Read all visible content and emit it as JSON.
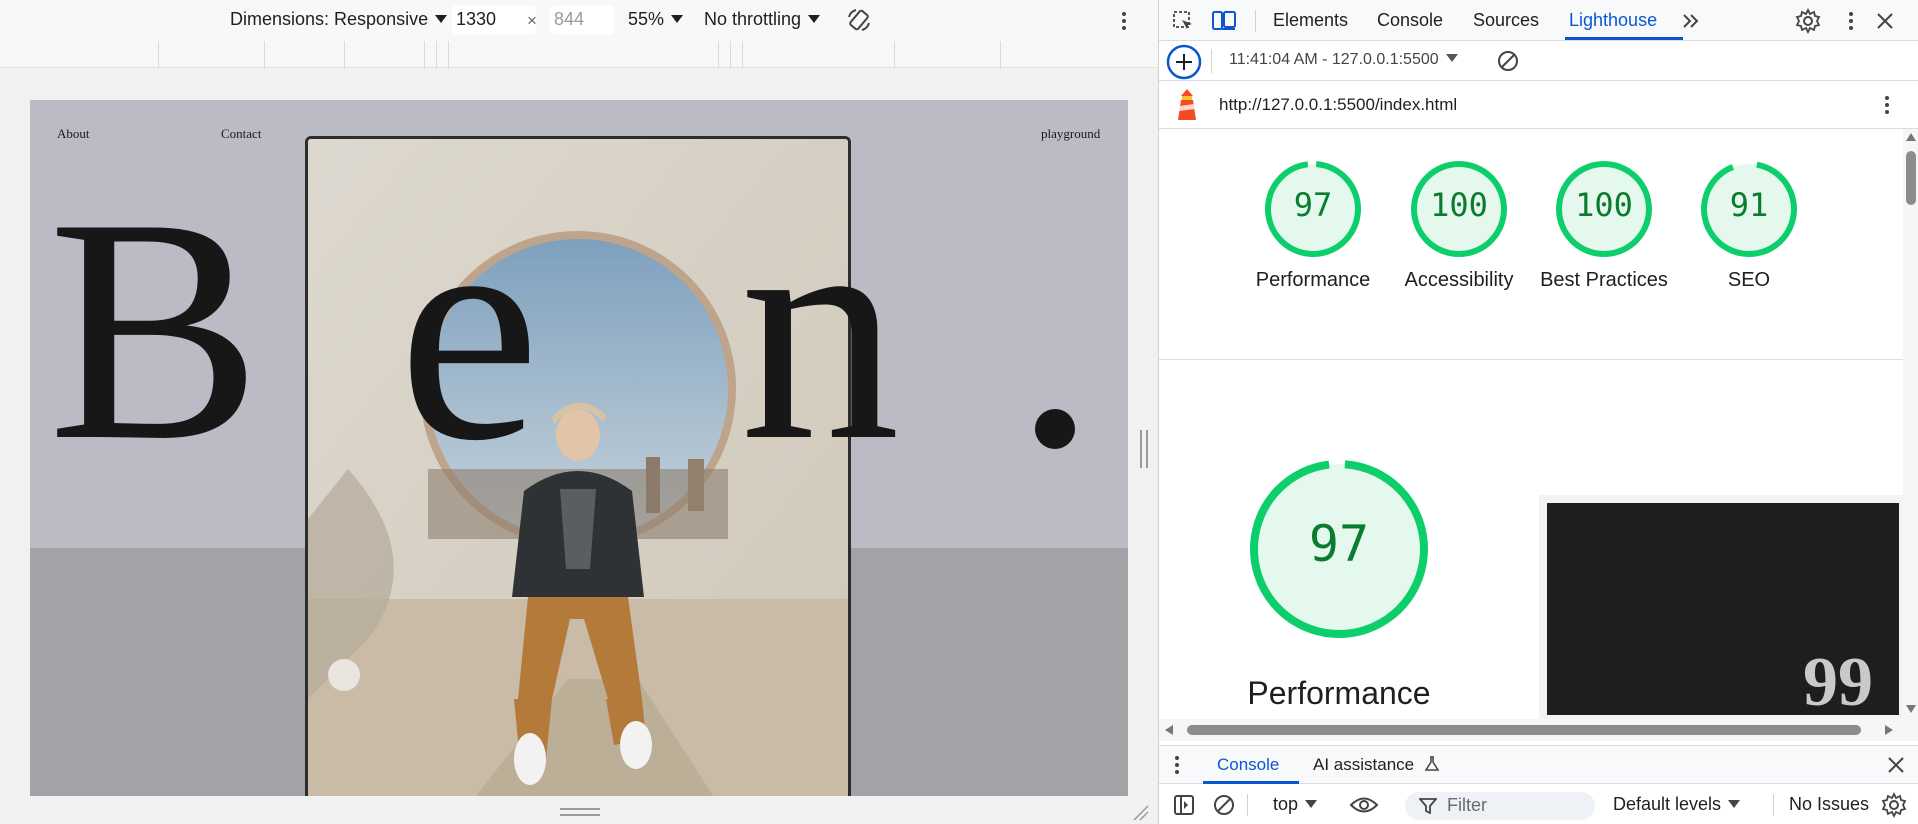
{
  "device_toolbar": {
    "dimensions_label": "Dimensions: Responsive",
    "width_value": "1330",
    "times_symbol": "×",
    "height_placeholder": "844",
    "zoom": "55%",
    "throttling": "No throttling"
  },
  "viewport_page": {
    "nav_about": "About",
    "nav_contact": "Contact",
    "nav_playground": "playground",
    "hero_letters": [
      "B",
      "e",
      "n"
    ],
    "colors": {
      "background": "#bbbbc6",
      "floor": "#a3a3a7",
      "ink": "#171717"
    }
  },
  "devtools": {
    "tabs": [
      "Elements",
      "Console",
      "Sources",
      "Lighthouse"
    ],
    "active_tab": "Lighthouse",
    "report_selector": "11:41:04 AM - 127.0.0.1:5500",
    "report_url": "http://127.0.0.1:5500/index.html",
    "scores": [
      {
        "value": "97",
        "label": "Performance"
      },
      {
        "value": "100",
        "label": "Accessibility"
      },
      {
        "value": "100",
        "label": "Best Practices"
      },
      {
        "value": "91",
        "label": "SEO"
      }
    ],
    "main_gauge": {
      "value": "97",
      "label": "Performance"
    },
    "screenshot_number": "99",
    "colors": {
      "pass_green": "#0cce6b",
      "pass_text": "#0a7c2f",
      "accent": "#0b57d0"
    }
  },
  "drawer": {
    "tabs": [
      "Console",
      "AI assistance"
    ],
    "context": "top",
    "filter_placeholder": "Filter",
    "levels": "Default levels",
    "issues": "No Issues"
  }
}
